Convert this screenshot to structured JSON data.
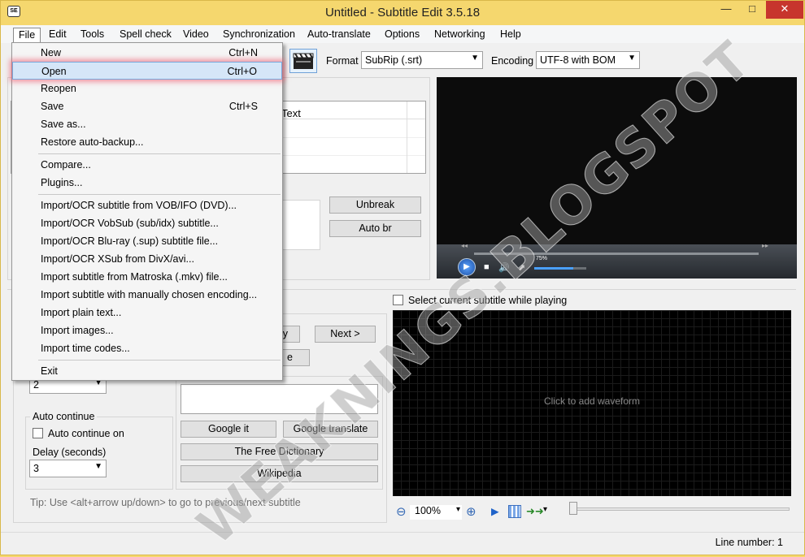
{
  "window": {
    "app_icon": "SE",
    "title": "Untitled - Subtitle Edit 3.5.18",
    "min": "—",
    "max": "□",
    "close": "✕"
  },
  "menu": [
    "File",
    "Edit",
    "Tools",
    "Spell check",
    "Video",
    "Synchronization",
    "Auto-translate",
    "Options",
    "Networking",
    "Help"
  ],
  "toolbar": {
    "format_label": "Format",
    "format_value": "SubRip (.srt)",
    "encoding_label": "Encoding",
    "encoding_value": "UTF-8 with BOM"
  },
  "grid": {
    "text_header": "Text"
  },
  "buttons": {
    "unbreak": "Unbreak",
    "auto_br": "Auto br",
    "play_partial": "y",
    "next": "Next >",
    "pause_partial": "e",
    "google_it": "Google it",
    "google_translate": "Google translate",
    "free_dictionary": "The Free Dictionary",
    "wikipedia": "Wikipedia"
  },
  "video": {
    "volume_pct": "75%",
    "volume_level": 0.75,
    "rewind_icon": "◂◂",
    "forward_icon": "▸▸",
    "play_icon": "▶",
    "stop_icon": "■",
    "speaker_icon": "🔊",
    "fullscreen_icon": "⬈"
  },
  "select_current": "Select current subtitle while playing",
  "waveform": {
    "placeholder": "Click to add waveform",
    "zoom": "100%",
    "zoom_out_icon": "⊖",
    "zoom_in_icon": "⊕",
    "play_icon": "▶",
    "dropdown_icon": "▾"
  },
  "auto_continue": {
    "title": "Auto continue",
    "checkbox_label": "Auto continue on",
    "delay_label": "Delay (seconds)",
    "delay_value": "3",
    "top_value": "2"
  },
  "tip": "Tip: Use <alt+arrow up/down> to go to previous/next subtitle",
  "status": {
    "line_number": "Line number: 1"
  },
  "file_menu": [
    {
      "label": "New",
      "shortcut": "Ctrl+N"
    },
    {
      "label": "Open",
      "shortcut": "Ctrl+O"
    },
    {
      "label": "Reopen",
      "shortcut": ""
    },
    {
      "label": "Save",
      "shortcut": "Ctrl+S"
    },
    {
      "label": "Save as...",
      "shortcut": ""
    },
    {
      "label": "Restore auto-backup...",
      "shortcut": ""
    },
    {
      "label": "Compare...",
      "shortcut": ""
    },
    {
      "label": "Plugins...",
      "shortcut": ""
    },
    {
      "label": "Import/OCR subtitle from VOB/IFO (DVD)...",
      "shortcut": ""
    },
    {
      "label": "Import/OCR VobSub (sub/idx) subtitle...",
      "shortcut": ""
    },
    {
      "label": "Import/OCR Blu-ray (.sup) subtitle file...",
      "shortcut": ""
    },
    {
      "label": "Import/OCR XSub from DivX/avi...",
      "shortcut": ""
    },
    {
      "label": "Import subtitle from Matroska (.mkv) file...",
      "shortcut": ""
    },
    {
      "label": "Import subtitle with manually chosen encoding...",
      "shortcut": ""
    },
    {
      "label": "Import plain text...",
      "shortcut": ""
    },
    {
      "label": "Import images...",
      "shortcut": ""
    },
    {
      "label": "Import time codes...",
      "shortcut": ""
    },
    {
      "label": "Exit",
      "shortcut": ""
    }
  ],
  "watermark": "WEAKNINGS.BLOGSPOT"
}
